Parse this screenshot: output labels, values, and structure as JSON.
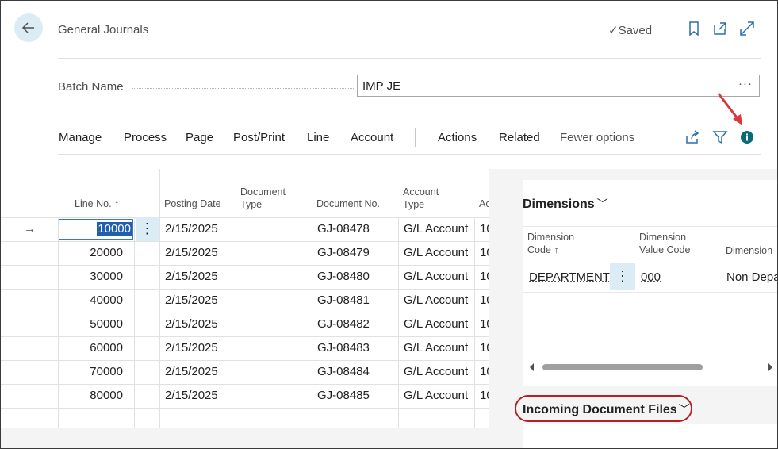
{
  "header": {
    "title": "General Journals",
    "saved_label": "Saved"
  },
  "batch": {
    "label": "Batch Name",
    "value": "IMP JE"
  },
  "action_bar": {
    "items": [
      "Manage",
      "Process",
      "Page",
      "Post/Print",
      "Line",
      "Account",
      "Actions",
      "Related"
    ],
    "fewer_options": "Fewer options"
  },
  "grid": {
    "headers": {
      "line_no": "Line No. ↑",
      "posting_date": "Posting Date",
      "document_type_1": "Document",
      "document_type_2": "Type",
      "document_no": "Document No.",
      "account_type_1": "Account",
      "account_type_2": "Type",
      "account_no": "Ac"
    },
    "rows": [
      {
        "line_no": "10000",
        "posting_date": "2/15/2025",
        "document_type": "",
        "document_no": "GJ-08478",
        "account_type": "G/L Account",
        "account_no": "10"
      },
      {
        "line_no": "20000",
        "posting_date": "2/15/2025",
        "document_type": "",
        "document_no": "GJ-08479",
        "account_type": "G/L Account",
        "account_no": "10"
      },
      {
        "line_no": "30000",
        "posting_date": "2/15/2025",
        "document_type": "",
        "document_no": "GJ-08480",
        "account_type": "G/L Account",
        "account_no": "10"
      },
      {
        "line_no": "40000",
        "posting_date": "2/15/2025",
        "document_type": "",
        "document_no": "GJ-08481",
        "account_type": "G/L Account",
        "account_no": "10"
      },
      {
        "line_no": "50000",
        "posting_date": "2/15/2025",
        "document_type": "",
        "document_no": "GJ-08482",
        "account_type": "G/L Account",
        "account_no": "10"
      },
      {
        "line_no": "60000",
        "posting_date": "2/15/2025",
        "document_type": "",
        "document_no": "GJ-08483",
        "account_type": "G/L Account",
        "account_no": "10"
      },
      {
        "line_no": "70000",
        "posting_date": "2/15/2025",
        "document_type": "",
        "document_no": "GJ-08484",
        "account_type": "G/L Account",
        "account_no": "10"
      },
      {
        "line_no": "80000",
        "posting_date": "2/15/2025",
        "document_type": "",
        "document_no": "GJ-08485",
        "account_type": "G/L Account",
        "account_no": "10"
      }
    ]
  },
  "factbox": {
    "dimensions": {
      "title": "Dimensions",
      "headers": {
        "code_1": "Dimension",
        "code_2": "Code ↑",
        "value_code_1": "Dimension",
        "value_code_2": "Value Code",
        "name": "Dimension"
      },
      "row": {
        "code": "DEPARTMENT",
        "value_code": "000",
        "name": "Non Depa"
      }
    },
    "incoming": {
      "title": "Incoming Document Files"
    }
  },
  "colors": {
    "accent": "#2a6fb0",
    "selection": "#1f5fad",
    "highlight_bg": "#dcecf5",
    "annotation": "#b22222",
    "info_icon": "#0b6a78"
  }
}
